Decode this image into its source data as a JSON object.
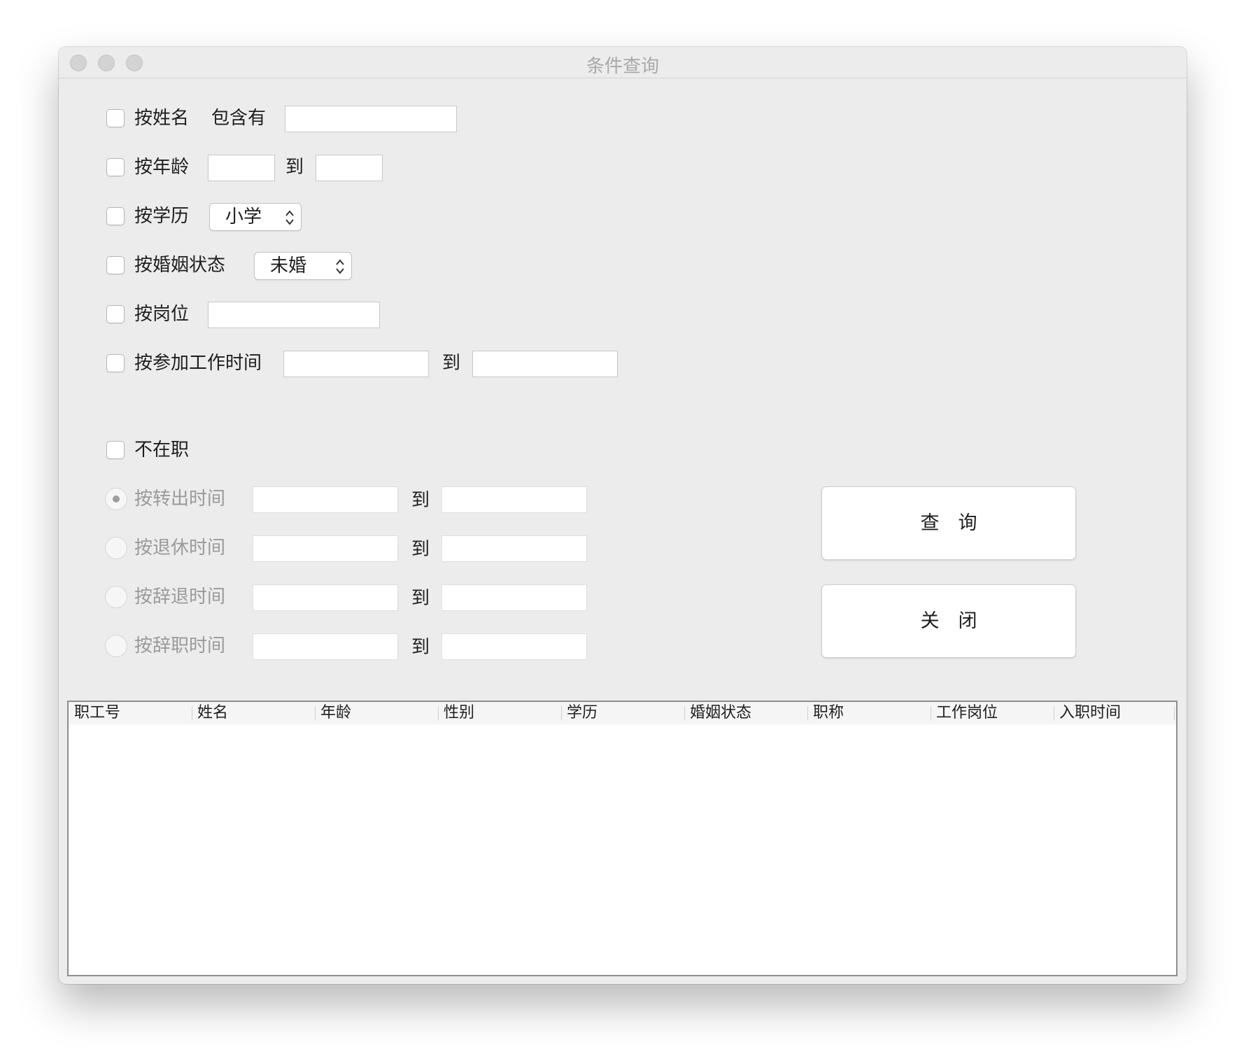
{
  "window": {
    "title": "条件查询"
  },
  "filters": {
    "name": {
      "checkbox_label": "按姓名",
      "contains_label": "包含有",
      "value": ""
    },
    "age": {
      "checkbox_label": "按年龄",
      "from": "",
      "to_label": "到",
      "to": ""
    },
    "education": {
      "checkbox_label": "按学历",
      "selected": "小学"
    },
    "marital": {
      "checkbox_label": "按婚姻状态",
      "selected": "未婚"
    },
    "position": {
      "checkbox_label": "按岗位",
      "value": ""
    },
    "work_start": {
      "checkbox_label": "按参加工作时间",
      "from": "",
      "to_label": "到",
      "to": ""
    }
  },
  "not_employed": {
    "checkbox_label": "不在职",
    "options": [
      {
        "label": "按转出时间",
        "to_label": "到",
        "selected": true
      },
      {
        "label": "按退休时间",
        "to_label": "到",
        "selected": false
      },
      {
        "label": "按辞退时间",
        "to_label": "到",
        "selected": false
      },
      {
        "label": "按辞职时间",
        "to_label": "到",
        "selected": false
      }
    ]
  },
  "buttons": {
    "query": "查　询",
    "close": "关　闭"
  },
  "table": {
    "columns": [
      "职工号",
      "姓名",
      "年龄",
      "性别",
      "学历",
      "婚姻状态",
      "职称",
      "工作岗位",
      "入职时间"
    ],
    "rows": []
  },
  "colors": {
    "window_bg": "#ececec",
    "disabled_text": "#9a9a9a",
    "table_border": "#8e8e8e"
  }
}
